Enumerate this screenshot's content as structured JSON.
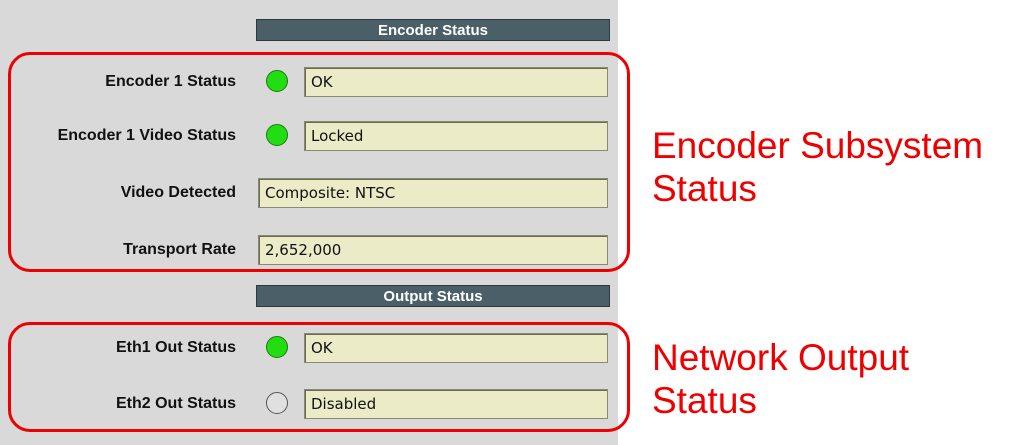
{
  "encoder_status": {
    "header": "Encoder Status",
    "rows": [
      {
        "label": "Encoder 1 Status",
        "indicator": "green",
        "value": "OK"
      },
      {
        "label": "Encoder 1 Video Status",
        "indicator": "green",
        "value": "Locked"
      },
      {
        "label": "Video Detected",
        "value": "Composite: NTSC"
      },
      {
        "label": "Transport Rate",
        "value": "2,652,000"
      }
    ]
  },
  "output_status": {
    "header": "Output Status",
    "rows": [
      {
        "label": "Eth1 Out Status",
        "indicator": "green",
        "value": "OK"
      },
      {
        "label": "Eth2 Out Status",
        "indicator": "off",
        "value": "Disabled"
      }
    ]
  },
  "callouts": {
    "encoder_line1": "Encoder Subsystem",
    "encoder_line2": "Status",
    "network_line1": "Network Output",
    "network_line2": "Status"
  },
  "colors": {
    "header_bg": "#4a5f68",
    "field_bg": "#ebebc7",
    "indicator_green": "#22dd11",
    "callout_red": "#ee0000"
  }
}
